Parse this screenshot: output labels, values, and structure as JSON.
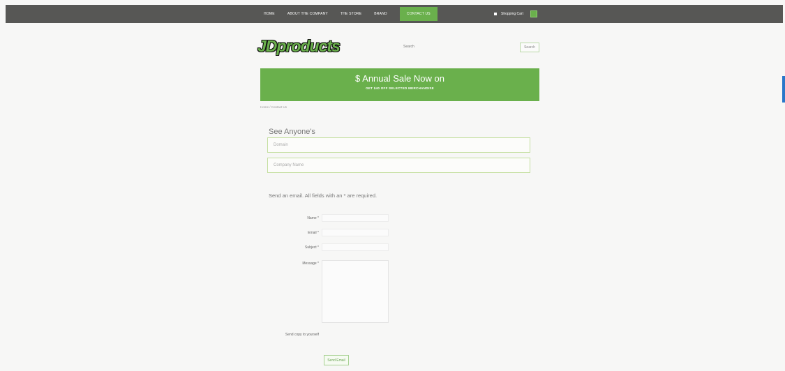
{
  "nav": {
    "items": [
      "Home",
      "About the Company",
      "The Store",
      "Brand",
      "Contact Us"
    ],
    "active_index": 4,
    "cart_label": "Shopping Cart"
  },
  "header": {
    "logo": "JDproducts",
    "search_placeholder": "Search",
    "search_button": "Search"
  },
  "banner": {
    "title": "$ Annual Sale Now on",
    "subtitle": "GET $40 OFF SELECTED MERCHANDISE"
  },
  "breadcrumb": "Home / Contact Us",
  "lookup": {
    "heading": "See Anyone's",
    "field1_placeholder": "Domain",
    "field2_placeholder": "Company Name"
  },
  "form": {
    "intro": "Send an email. All fields with an * are required.",
    "name_label": "Name *",
    "email_label": "Email *",
    "subject_label": "Subject *",
    "message_label": "Message *",
    "copy_label": "Send copy to yourself",
    "send_button": "Send Email"
  },
  "colors": {
    "topbar": "#575755",
    "accent": "#6ab04c",
    "side_tab": "#2a77c9"
  }
}
